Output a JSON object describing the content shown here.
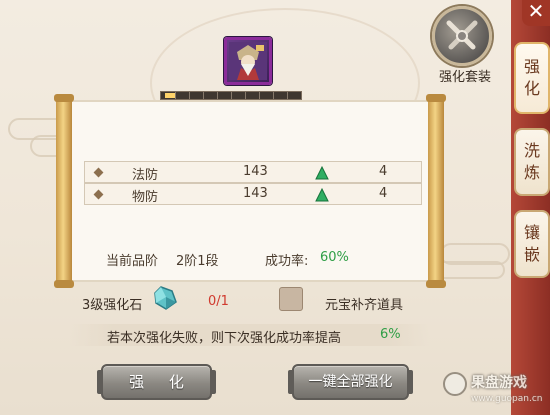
{
  "top_right": {
    "set_label": "强化套装"
  },
  "side_tabs": [
    {
      "label": "强化",
      "active": true
    },
    {
      "label": "洗炼",
      "active": false
    },
    {
      "label": "镶嵌",
      "active": false
    }
  ],
  "close_glyph": "✕",
  "item": {
    "icon": "armored-general-portrait-icon",
    "progress_segments_filled": 1,
    "progress_segments_total": 10
  },
  "stats": [
    {
      "name": "法防",
      "value": "143",
      "after": "4",
      "arrow": "green-up-triangle-icon"
    },
    {
      "name": "物防",
      "value": "143",
      "after": "4",
      "arrow": "green-up-triangle-icon"
    }
  ],
  "grade": {
    "label": "当前品阶",
    "value": "2阶1段"
  },
  "success": {
    "label": "成功率:",
    "value": "60%"
  },
  "material": {
    "label": "3级强化石",
    "count": "0/1",
    "gold_label": "元宝补齐道具"
  },
  "tip": {
    "text": "若本次强化失败，则下次强化成功率提高",
    "value": "6%"
  },
  "buttons": {
    "enhance": "强 化",
    "enhance_all": "一键全部强化"
  },
  "watermark": {
    "title": "果盘游戏",
    "url": "www.guopan.cn"
  },
  "colors": {
    "accent_red": "#a03626",
    "success_green": "#2f9e46",
    "count_red": "#d03a2e"
  }
}
